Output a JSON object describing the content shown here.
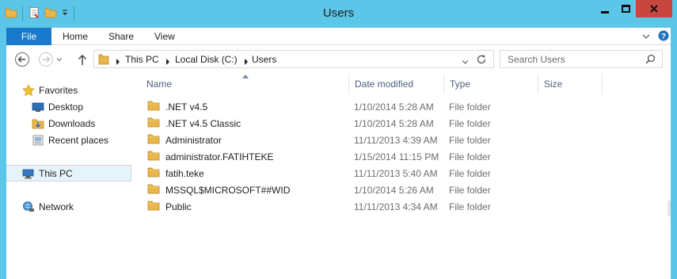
{
  "window": {
    "title": "Users",
    "colors": {
      "chrome": "#5bc6e8",
      "file_tab": "#1979ca",
      "close": "#c7463d",
      "selection": "#e5f3fb",
      "folder": "#e8b64a"
    }
  },
  "quick_access": {
    "icons": [
      "folder-icon",
      "properties-icon",
      "new-folder-icon",
      "customize-dropdown-icon"
    ]
  },
  "ribbon": {
    "file_label": "File",
    "tabs": [
      "Home",
      "Share",
      "View"
    ]
  },
  "address": {
    "crumbs": [
      "This PC",
      "Local Disk (C:)",
      "Users"
    ]
  },
  "search": {
    "placeholder": "Search Users"
  },
  "nav": {
    "favorites": "Favorites",
    "desktop": "Desktop",
    "downloads": "Downloads",
    "recent": "Recent places",
    "this_pc": "This PC",
    "network": "Network"
  },
  "columns": {
    "name": "Name",
    "date": "Date modified",
    "type": "Type",
    "size": "Size"
  },
  "files": [
    {
      "name": ".NET v4.5",
      "date": "1/10/2014 5:28 AM",
      "type": "File folder"
    },
    {
      "name": ".NET v4.5 Classic",
      "date": "1/10/2014 5:28 AM",
      "type": "File folder"
    },
    {
      "name": "Administrator",
      "date": "11/11/2013 4:39 AM",
      "type": "File folder"
    },
    {
      "name": "administrator.FATIHTEKE",
      "date": "1/15/2014 11:15 PM",
      "type": "File folder"
    },
    {
      "name": "fatih.teke",
      "date": "11/11/2013 5:40 AM",
      "type": "File folder"
    },
    {
      "name": "MSSQL$MICROSOFT##WID",
      "date": "1/10/2014 5:26 AM",
      "type": "File folder"
    },
    {
      "name": "Public",
      "date": "11/11/2013 4:34 AM",
      "type": "File folder"
    }
  ]
}
